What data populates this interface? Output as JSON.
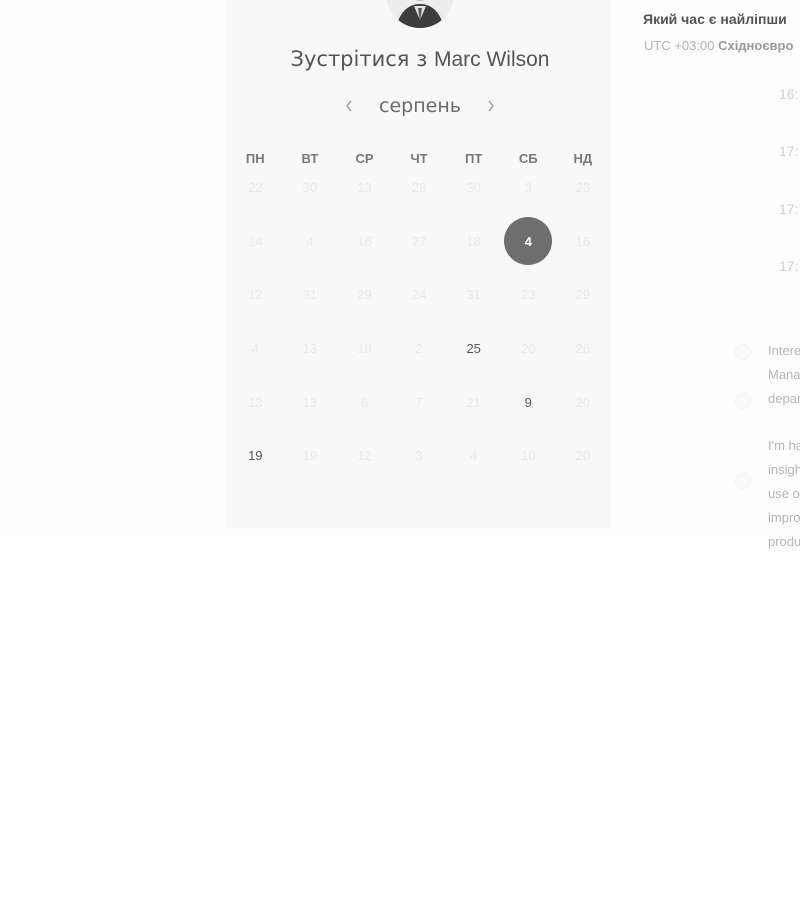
{
  "title": {
    "prefix": "Зустрітися з",
    "name": "Marc Wilson"
  },
  "calendar": {
    "month": "серпень",
    "prev_icon": "chevron-left-icon",
    "next_icon": "chevron-right-icon",
    "weekdays": [
      "ПН",
      "ВТ",
      "СР",
      "ЧТ",
      "ПТ",
      "СБ",
      "НД"
    ],
    "weeks": [
      [
        "22",
        "30",
        "13",
        "28",
        "30",
        "3",
        "23"
      ],
      [
        "14",
        "4",
        "16",
        "27",
        "18",
        "4",
        "16"
      ],
      [
        "12",
        "31",
        "29",
        "24",
        "31",
        "23",
        "29"
      ],
      [
        "4",
        "13",
        "19",
        "2",
        "25",
        "20",
        "26"
      ],
      [
        "13",
        "13",
        "6",
        "7",
        "21",
        "9",
        "20"
      ],
      [
        "19",
        "19",
        "12",
        "3",
        "4",
        "10",
        "20"
      ]
    ],
    "available": [
      [
        3,
        4
      ],
      [
        4,
        5
      ],
      [
        5,
        0
      ]
    ],
    "selected": [
      1,
      5
    ],
    "selected_color": "#6e6e6e"
  },
  "right": {
    "question": "Який час є найліпши",
    "timezone_offset": "UTC +03:00",
    "timezone_name": "Східноєвро",
    "slots": [
      "16:",
      "17:",
      "17:",
      "17:"
    ],
    "topics": [
      [
        "Intere",
        "Mana",
        "depar"
      ],
      [
        "I'm ha",
        "insigh",
        "use o",
        "impro",
        "produ"
      ]
    ]
  }
}
